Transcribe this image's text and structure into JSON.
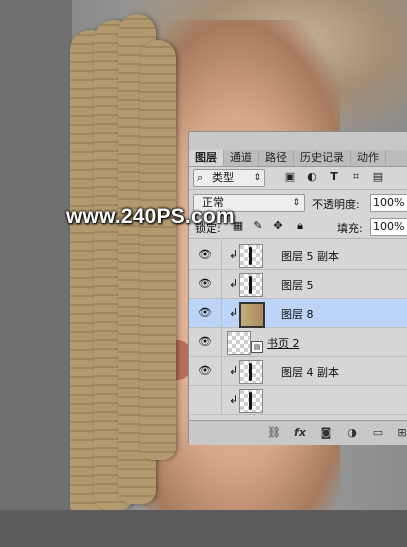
{
  "watermark": "www.240PS.com",
  "panel": {
    "tabs": [
      {
        "label": "图层",
        "active": true
      },
      {
        "label": "通道",
        "active": false
      },
      {
        "label": "路径",
        "active": false
      },
      {
        "label": "历史记录",
        "active": false
      },
      {
        "label": "动作",
        "active": false
      }
    ],
    "filter": {
      "label": "类型",
      "icon": "search-icon"
    },
    "blend_mode": "正常",
    "opacity_label": "不透明度:",
    "opacity_value": "100%",
    "lock_label": "锁定:",
    "fill_label": "填充:",
    "fill_value": "100%",
    "layers": [
      {
        "name": "图层 5 副本",
        "clipped": true,
        "thumb": "mask",
        "selected": false
      },
      {
        "name": "图层 5",
        "clipped": true,
        "thumb": "mask",
        "selected": false
      },
      {
        "name": "图层 8",
        "clipped": true,
        "thumb": "paper",
        "selected": true
      },
      {
        "name": "书页 2",
        "clipped": false,
        "thumb": "smart",
        "selected": false
      },
      {
        "name": "图层 4 副本",
        "clipped": true,
        "thumb": "mask",
        "selected": false
      }
    ],
    "footer_icons": [
      "link-icon",
      "fx-icon",
      "mask-icon",
      "adjustment-icon",
      "group-folder-icon",
      "new-layer-icon"
    ]
  },
  "colors": {
    "selected_row": "#bcd4f7",
    "panel_bg": "#d6d6d6"
  }
}
